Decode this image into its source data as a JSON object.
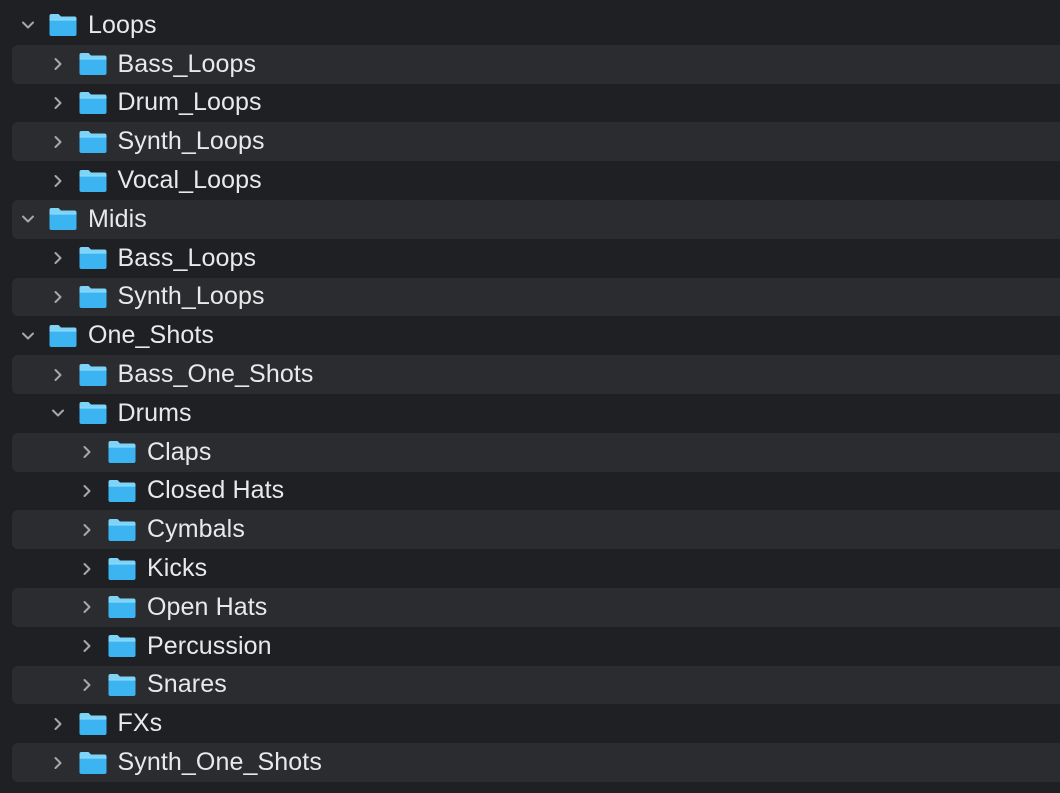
{
  "tree": {
    "rows": [
      {
        "label": "Loops",
        "level": 0,
        "expanded": true
      },
      {
        "label": "Bass_Loops",
        "level": 1,
        "expanded": false
      },
      {
        "label": "Drum_Loops",
        "level": 1,
        "expanded": false
      },
      {
        "label": "Synth_Loops",
        "level": 1,
        "expanded": false
      },
      {
        "label": "Vocal_Loops",
        "level": 1,
        "expanded": false
      },
      {
        "label": "Midis",
        "level": 0,
        "expanded": true
      },
      {
        "label": "Bass_Loops",
        "level": 1,
        "expanded": false
      },
      {
        "label": "Synth_Loops",
        "level": 1,
        "expanded": false
      },
      {
        "label": "One_Shots",
        "level": 0,
        "expanded": true
      },
      {
        "label": "Bass_One_Shots",
        "level": 1,
        "expanded": false
      },
      {
        "label": "Drums",
        "level": 1,
        "expanded": true
      },
      {
        "label": "Claps",
        "level": 2,
        "expanded": false
      },
      {
        "label": "Closed Hats",
        "level": 2,
        "expanded": false
      },
      {
        "label": "Cymbals",
        "level": 2,
        "expanded": false
      },
      {
        "label": "Kicks",
        "level": 2,
        "expanded": false
      },
      {
        "label": "Open Hats",
        "level": 2,
        "expanded": false
      },
      {
        "label": "Percussion",
        "level": 2,
        "expanded": false
      },
      {
        "label": "Snares",
        "level": 2,
        "expanded": false
      },
      {
        "label": "FXs",
        "level": 1,
        "expanded": false
      },
      {
        "label": "Synth_One_Shots",
        "level": 1,
        "expanded": false
      }
    ]
  },
  "icons": {
    "folder": "folder-icon",
    "expanded": "chevron-down-icon",
    "collapsed": "chevron-right-icon"
  },
  "colors": {
    "background": "#1f2024",
    "row_alt": "#2b2c30",
    "folder_top": "#7dd3f8",
    "folder_body": "#3db4f2",
    "text": "#e9e9ea",
    "chevron": "#a7a8ab"
  }
}
